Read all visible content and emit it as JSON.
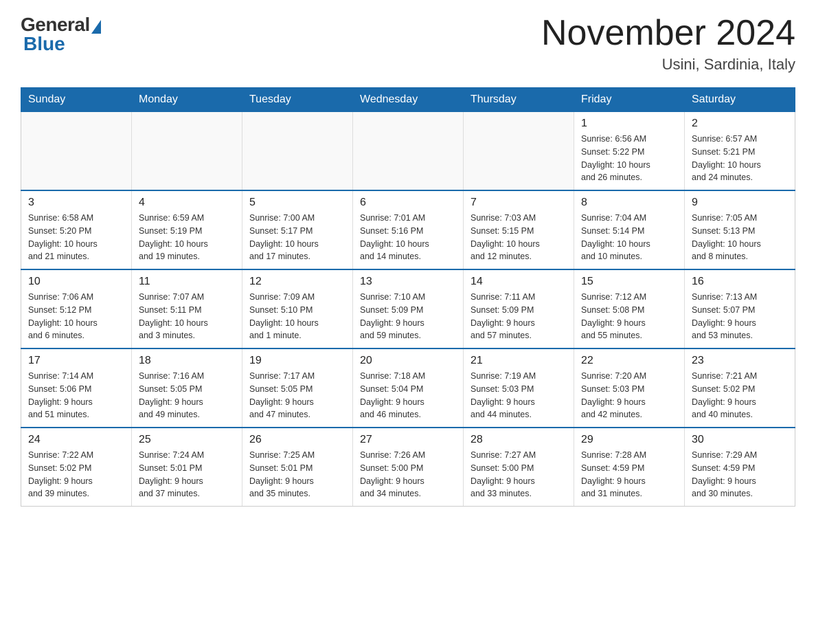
{
  "header": {
    "logo_general": "General",
    "logo_blue": "Blue",
    "title": "November 2024",
    "subtitle": "Usini, Sardinia, Italy"
  },
  "weekdays": [
    "Sunday",
    "Monday",
    "Tuesday",
    "Wednesday",
    "Thursday",
    "Friday",
    "Saturday"
  ],
  "weeks": [
    [
      {
        "day": "",
        "info": ""
      },
      {
        "day": "",
        "info": ""
      },
      {
        "day": "",
        "info": ""
      },
      {
        "day": "",
        "info": ""
      },
      {
        "day": "",
        "info": ""
      },
      {
        "day": "1",
        "info": "Sunrise: 6:56 AM\nSunset: 5:22 PM\nDaylight: 10 hours\nand 26 minutes."
      },
      {
        "day": "2",
        "info": "Sunrise: 6:57 AM\nSunset: 5:21 PM\nDaylight: 10 hours\nand 24 minutes."
      }
    ],
    [
      {
        "day": "3",
        "info": "Sunrise: 6:58 AM\nSunset: 5:20 PM\nDaylight: 10 hours\nand 21 minutes."
      },
      {
        "day": "4",
        "info": "Sunrise: 6:59 AM\nSunset: 5:19 PM\nDaylight: 10 hours\nand 19 minutes."
      },
      {
        "day": "5",
        "info": "Sunrise: 7:00 AM\nSunset: 5:17 PM\nDaylight: 10 hours\nand 17 minutes."
      },
      {
        "day": "6",
        "info": "Sunrise: 7:01 AM\nSunset: 5:16 PM\nDaylight: 10 hours\nand 14 minutes."
      },
      {
        "day": "7",
        "info": "Sunrise: 7:03 AM\nSunset: 5:15 PM\nDaylight: 10 hours\nand 12 minutes."
      },
      {
        "day": "8",
        "info": "Sunrise: 7:04 AM\nSunset: 5:14 PM\nDaylight: 10 hours\nand 10 minutes."
      },
      {
        "day": "9",
        "info": "Sunrise: 7:05 AM\nSunset: 5:13 PM\nDaylight: 10 hours\nand 8 minutes."
      }
    ],
    [
      {
        "day": "10",
        "info": "Sunrise: 7:06 AM\nSunset: 5:12 PM\nDaylight: 10 hours\nand 6 minutes."
      },
      {
        "day": "11",
        "info": "Sunrise: 7:07 AM\nSunset: 5:11 PM\nDaylight: 10 hours\nand 3 minutes."
      },
      {
        "day": "12",
        "info": "Sunrise: 7:09 AM\nSunset: 5:10 PM\nDaylight: 10 hours\nand 1 minute."
      },
      {
        "day": "13",
        "info": "Sunrise: 7:10 AM\nSunset: 5:09 PM\nDaylight: 9 hours\nand 59 minutes."
      },
      {
        "day": "14",
        "info": "Sunrise: 7:11 AM\nSunset: 5:09 PM\nDaylight: 9 hours\nand 57 minutes."
      },
      {
        "day": "15",
        "info": "Sunrise: 7:12 AM\nSunset: 5:08 PM\nDaylight: 9 hours\nand 55 minutes."
      },
      {
        "day": "16",
        "info": "Sunrise: 7:13 AM\nSunset: 5:07 PM\nDaylight: 9 hours\nand 53 minutes."
      }
    ],
    [
      {
        "day": "17",
        "info": "Sunrise: 7:14 AM\nSunset: 5:06 PM\nDaylight: 9 hours\nand 51 minutes."
      },
      {
        "day": "18",
        "info": "Sunrise: 7:16 AM\nSunset: 5:05 PM\nDaylight: 9 hours\nand 49 minutes."
      },
      {
        "day": "19",
        "info": "Sunrise: 7:17 AM\nSunset: 5:05 PM\nDaylight: 9 hours\nand 47 minutes."
      },
      {
        "day": "20",
        "info": "Sunrise: 7:18 AM\nSunset: 5:04 PM\nDaylight: 9 hours\nand 46 minutes."
      },
      {
        "day": "21",
        "info": "Sunrise: 7:19 AM\nSunset: 5:03 PM\nDaylight: 9 hours\nand 44 minutes."
      },
      {
        "day": "22",
        "info": "Sunrise: 7:20 AM\nSunset: 5:03 PM\nDaylight: 9 hours\nand 42 minutes."
      },
      {
        "day": "23",
        "info": "Sunrise: 7:21 AM\nSunset: 5:02 PM\nDaylight: 9 hours\nand 40 minutes."
      }
    ],
    [
      {
        "day": "24",
        "info": "Sunrise: 7:22 AM\nSunset: 5:02 PM\nDaylight: 9 hours\nand 39 minutes."
      },
      {
        "day": "25",
        "info": "Sunrise: 7:24 AM\nSunset: 5:01 PM\nDaylight: 9 hours\nand 37 minutes."
      },
      {
        "day": "26",
        "info": "Sunrise: 7:25 AM\nSunset: 5:01 PM\nDaylight: 9 hours\nand 35 minutes."
      },
      {
        "day": "27",
        "info": "Sunrise: 7:26 AM\nSunset: 5:00 PM\nDaylight: 9 hours\nand 34 minutes."
      },
      {
        "day": "28",
        "info": "Sunrise: 7:27 AM\nSunset: 5:00 PM\nDaylight: 9 hours\nand 33 minutes."
      },
      {
        "day": "29",
        "info": "Sunrise: 7:28 AM\nSunset: 4:59 PM\nDaylight: 9 hours\nand 31 minutes."
      },
      {
        "day": "30",
        "info": "Sunrise: 7:29 AM\nSunset: 4:59 PM\nDaylight: 9 hours\nand 30 minutes."
      }
    ]
  ]
}
